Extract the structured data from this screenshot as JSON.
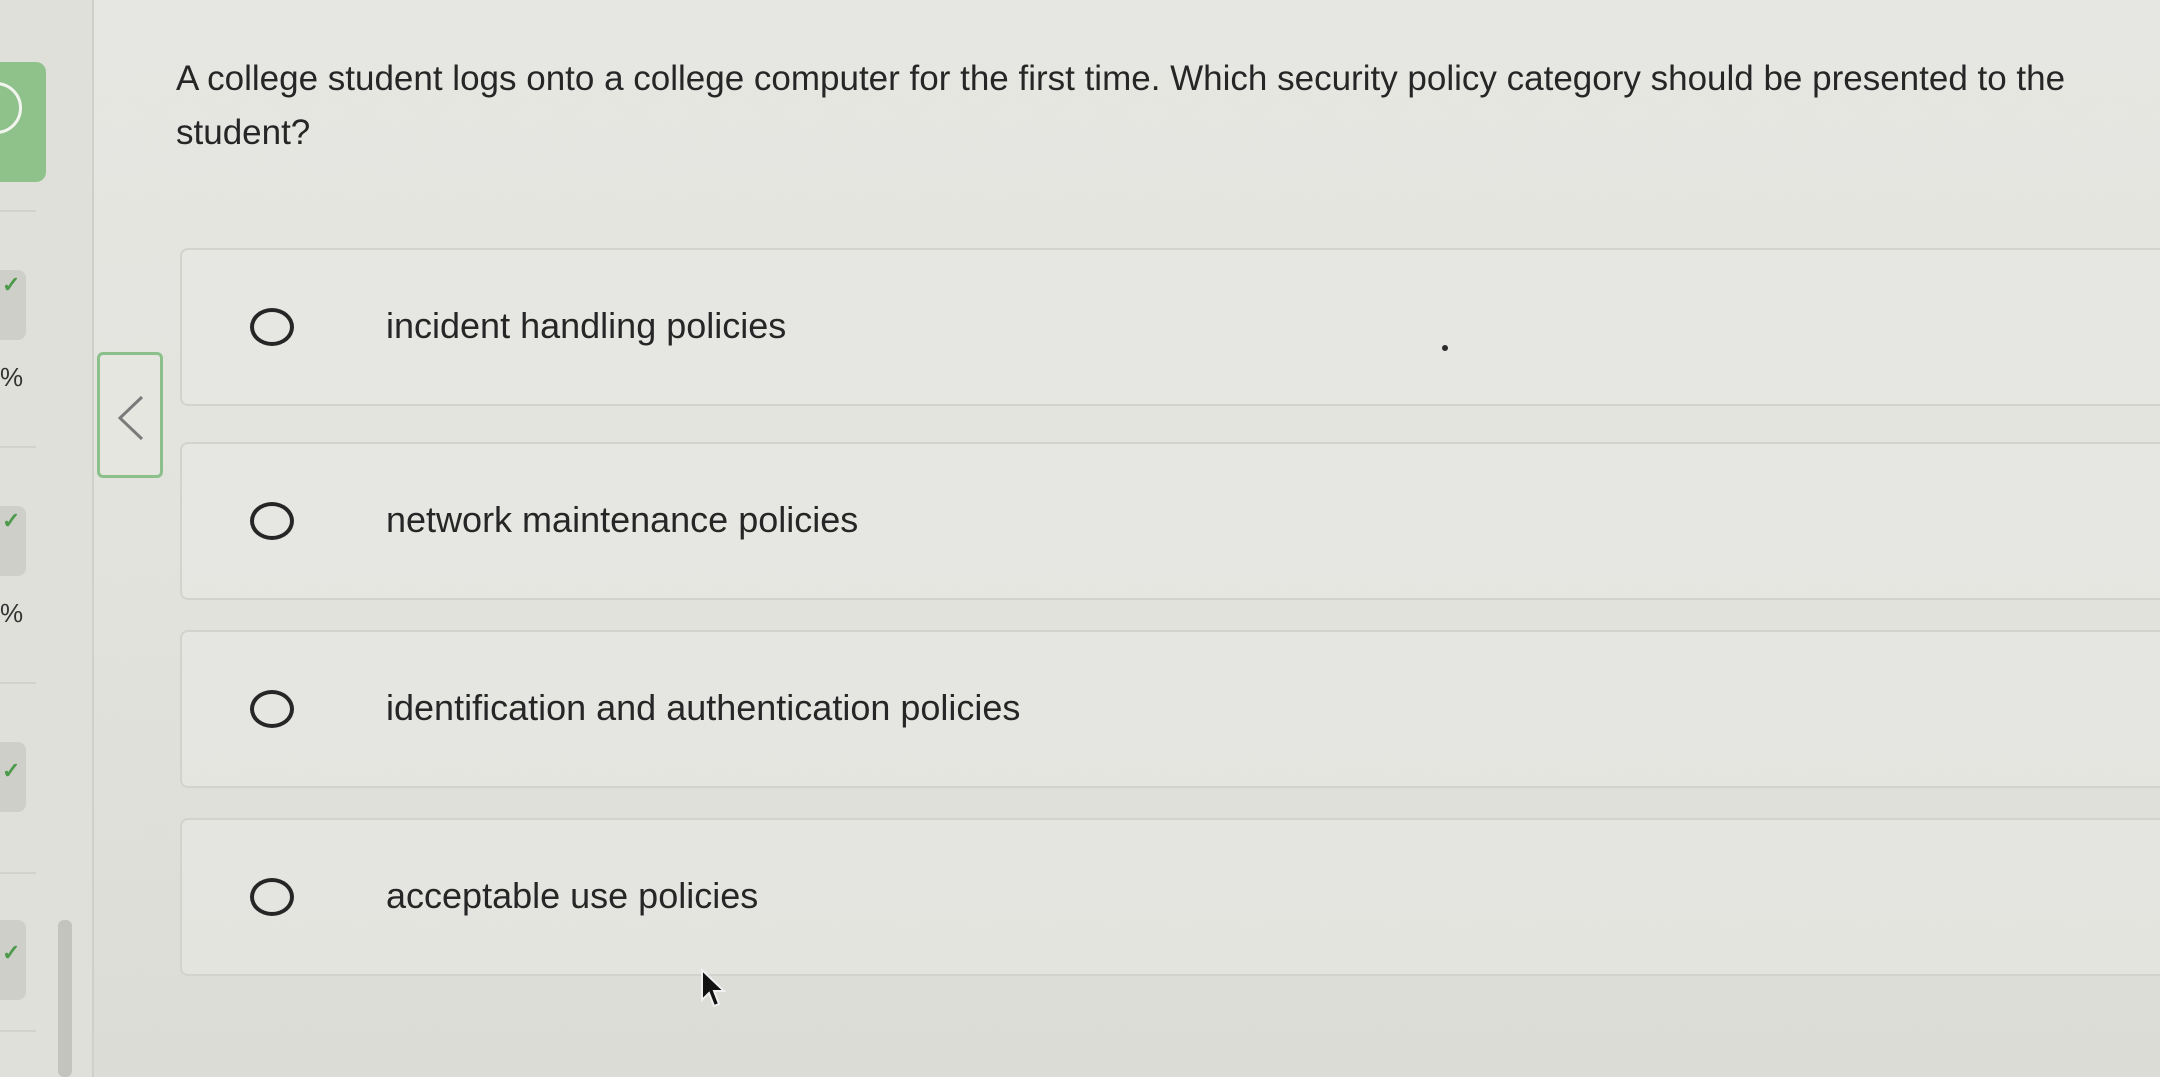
{
  "sidebar": {
    "progress_items": [
      {
        "value": "%"
      },
      {
        "value": "%"
      }
    ]
  },
  "question": {
    "text": "A college student logs onto a college computer for the first time. Which security policy category should be presented to the student?"
  },
  "options": [
    {
      "label": "incident handling policies"
    },
    {
      "label": "network maintenance policies"
    },
    {
      "label": "identification and authentication policies"
    },
    {
      "label": "acceptable use policies"
    }
  ],
  "colors": {
    "accent_green": "#8cc08a",
    "background": "#e4e4df",
    "text": "#262626"
  },
  "icons": {
    "collapse": "chevron-left-icon",
    "radio": "radio-unchecked-icon",
    "cursor": "mouse-pointer-icon"
  }
}
